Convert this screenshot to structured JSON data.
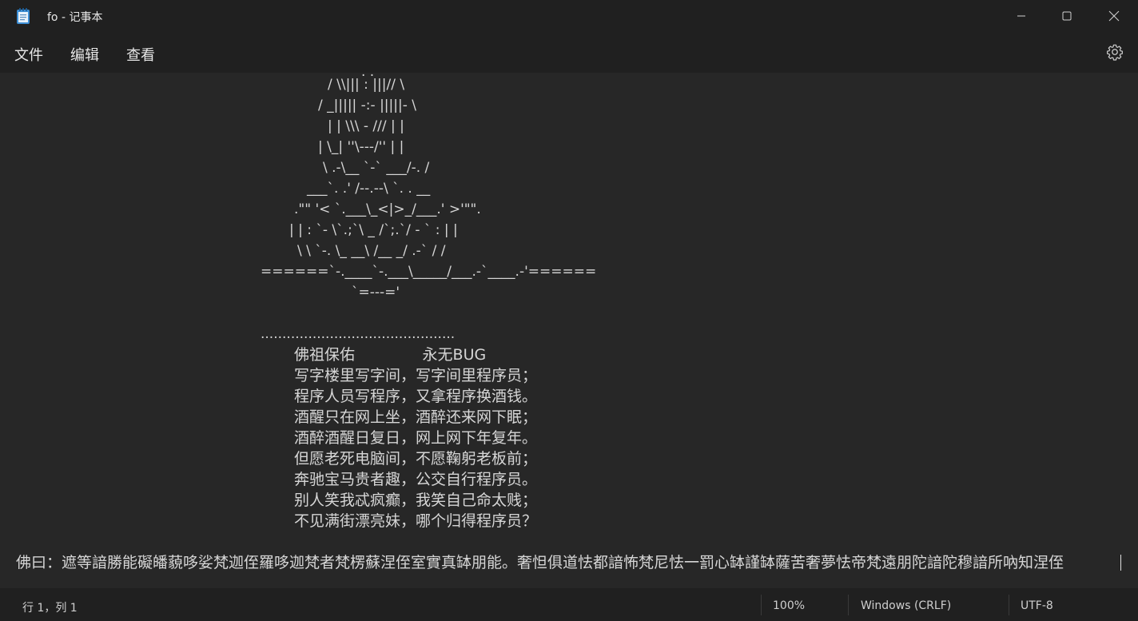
{
  "window": {
    "title": "fo - 记事本"
  },
  "menu": {
    "file": "文件",
    "edit": "编辑",
    "view": "查看"
  },
  "ascii_art": [
    ". .",
    "/ \\\\||| : |||// \\",
    "/ _||||| -:- |||||- \\",
    "| | \\\\\\ - /// | |",
    "| \\_| ''\\---/'' | |",
    "\\ .-\\__ `-` ___/-. /",
    "___`. .' /--.--\\ `. . __",
    ".\"\" '< `.___\\_<|>_/___.' >'\"\".",
    "| | : `- \\`.;`\\ _ /`;.`/ - ` : | |",
    "\\ \\ `-. \\_ __\\ /__ _/ .-` / /",
    "======`-.____`-.___\\_____/___.-`____.-'======",
    "`=---='",
    "............................................."
  ],
  "poem": [
    "佛祖保佑              永无BUG",
    "写字楼里写字间，写字间里程序员；",
    "程序人员写程序，又拿程序换酒钱。",
    "酒醒只在网上坐，酒醉还来网下眠；",
    "酒醉酒醒日复日，网上网下年复年。",
    "但愿老死电脑间，不愿鞠躬老板前；",
    "奔驰宝马贵者趣，公交自行程序员。",
    "别人笑我忒疯癫，我笑自己命太贱；",
    "不见满街漂亮妹，哪个归得程序员？"
  ],
  "bottom_line": "佛曰：遮等諳勝能礙皤藐哆娑梵迦侄羅哆迦梵者梵楞蘇涅侄室實真缽朋能。奢怛俱道怯都諳怖梵尼怯一罰心缽謹缽薩苦奢夢怯帝梵遠朋陀諳陀穆諳所吶知涅侄",
  "status": {
    "position": "行 1，列 1",
    "zoom": "100%",
    "line_ending": "Windows (CRLF)",
    "encoding": "UTF-8"
  },
  "icons": {
    "app": "notepad-icon",
    "minimize": "minimize-icon",
    "maximize": "maximize-icon",
    "close": "close-icon",
    "settings": "gear-icon"
  },
  "colors": {
    "titlebar": "#202020",
    "editor_bg": "#272727",
    "text": "#d6d6d6",
    "accent": "#4aa8e8"
  }
}
